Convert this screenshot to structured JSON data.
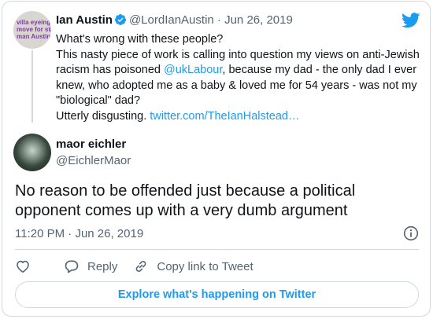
{
  "quoted_tweet": {
    "avatar_lines": [
      "villa eyeing",
      "move for sta",
      "man Austin"
    ],
    "name": "Ian Austin",
    "handle": "@LordIanAustin",
    "separator": "·",
    "date": "Jun 26, 2019",
    "line1": "What's wrong with these people?",
    "line2_pre": "This nasty piece of work is calling into question my views on anti-Jewish racism has poisoned ",
    "mention": "@ukLabour",
    "line2_post": ", because my dad - the only dad I ever knew, who adopted me as a baby & loved me for 54 years - was not my \"biological\" dad?",
    "line3_pre": "Utterly disgusting. ",
    "link": "twitter.com/TheIanHalstead…"
  },
  "main_tweet": {
    "name": "maor eichler",
    "handle": "@EichlerMaor",
    "text": "No reason to be offended just because a political opponent comes up with a very dumb argument",
    "time": "11:20 PM",
    "separator": "·",
    "date": "Jun 26, 2019"
  },
  "actions": {
    "reply": "Reply",
    "copy_link": "Copy link to Tweet"
  },
  "explore_button": "Explore what's happening on Twitter",
  "colors": {
    "accent": "#1d9bf0",
    "muted": "#536471",
    "border": "#cfd9de"
  }
}
